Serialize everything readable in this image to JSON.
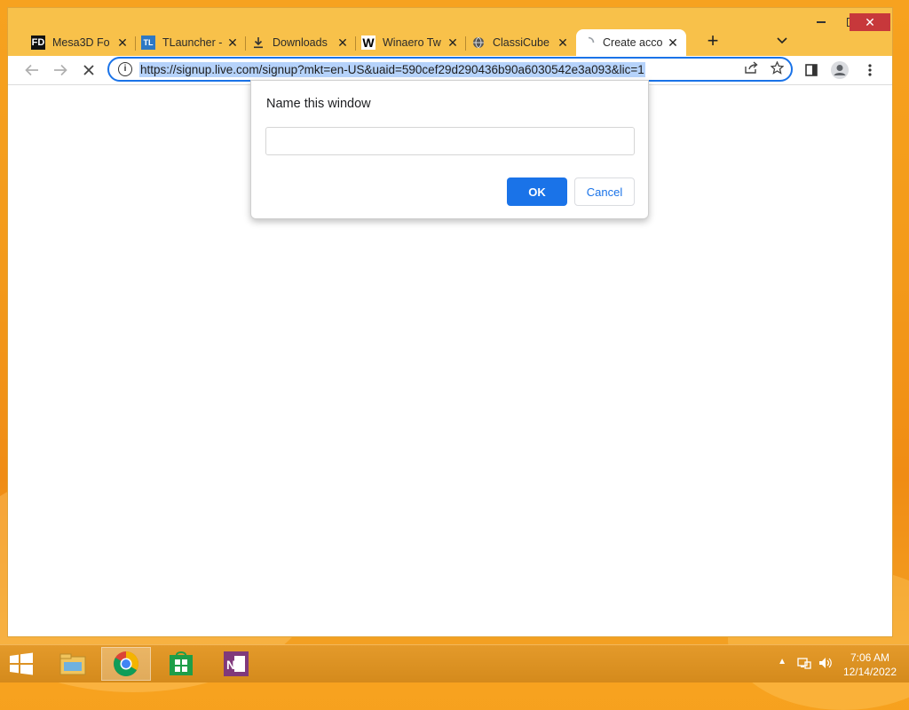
{
  "browser": {
    "tabs": [
      {
        "title": "Mesa3D Fo",
        "favicon": "FD",
        "favicon_icon": "mesa3d-favicon-icon",
        "active": false
      },
      {
        "title": "TLauncher -",
        "favicon": "TL",
        "favicon_icon": "tlauncher-favicon-icon",
        "active": false
      },
      {
        "title": "Downloads",
        "favicon": "",
        "favicon_icon": "download-icon",
        "active": false
      },
      {
        "title": "Winaero Tw",
        "favicon": "W",
        "favicon_icon": "winaero-favicon-icon",
        "active": false
      },
      {
        "title": "ClassiCube",
        "favicon": "",
        "favicon_icon": "globe-icon",
        "active": false
      },
      {
        "title": "Create acco",
        "favicon": "",
        "favicon_icon": "loading-spinner-icon",
        "active": true
      }
    ],
    "url": "https://signup.live.com/signup?mkt=en-US&uaid=590cef29d290436b90a6030542e3a093&lic=1",
    "accent_color": "#1a73e8"
  },
  "dialog": {
    "title": "Name this window",
    "input_value": "",
    "input_placeholder": "",
    "ok_label": "OK",
    "cancel_label": "Cancel"
  },
  "taskbar": {
    "apps": [
      "file-explorer-icon",
      "chrome-icon",
      "store-icon",
      "onenote-icon"
    ],
    "clock_time": "7:06 AM",
    "clock_date": "12/14/2022"
  }
}
